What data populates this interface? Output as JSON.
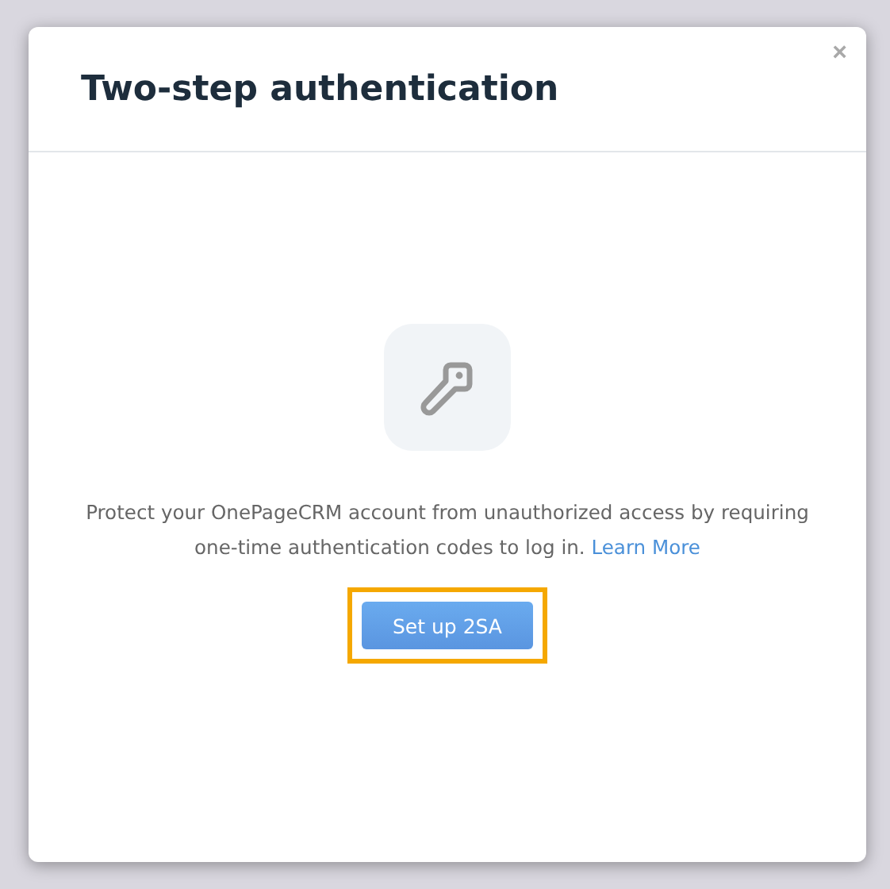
{
  "dialog": {
    "title": "Two-step authentication",
    "close": "×",
    "description": "Protect your OnePageCRM account from unauthorized access by requiring one-time authentication codes to log in.",
    "link": "Learn More",
    "button": {
      "label": "Set up 2SA",
      "highlighted": true
    }
  }
}
